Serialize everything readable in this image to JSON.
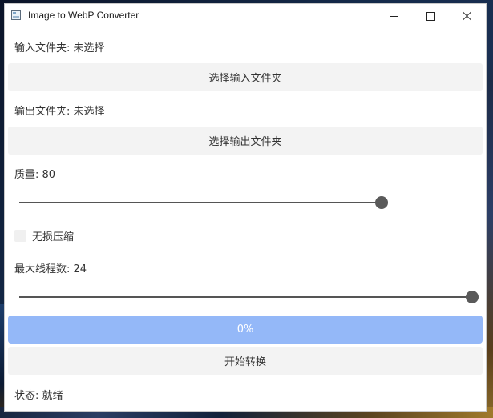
{
  "window": {
    "title": "Image to WebP Converter"
  },
  "input": {
    "folder_label": "输入文件夹: 未选择",
    "select_button": "选择输入文件夹"
  },
  "output": {
    "folder_label": "输出文件夹: 未选择",
    "select_button": "选择输出文件夹"
  },
  "quality": {
    "label": "质量: 80",
    "value": 80,
    "min": 0,
    "max": 100
  },
  "lossless": {
    "label": "无损压缩",
    "checked": false
  },
  "threads": {
    "label": "最大线程数: 24",
    "value": 24,
    "min": 1,
    "max": 24
  },
  "progress": {
    "value": 0,
    "text": "0%"
  },
  "start_button": "开始转换",
  "status": "状态: 就绪",
  "colors": {
    "progress_fill": "#94b8f8",
    "button_bg": "#f3f3f3",
    "slider_handle": "#5a5a5a"
  }
}
